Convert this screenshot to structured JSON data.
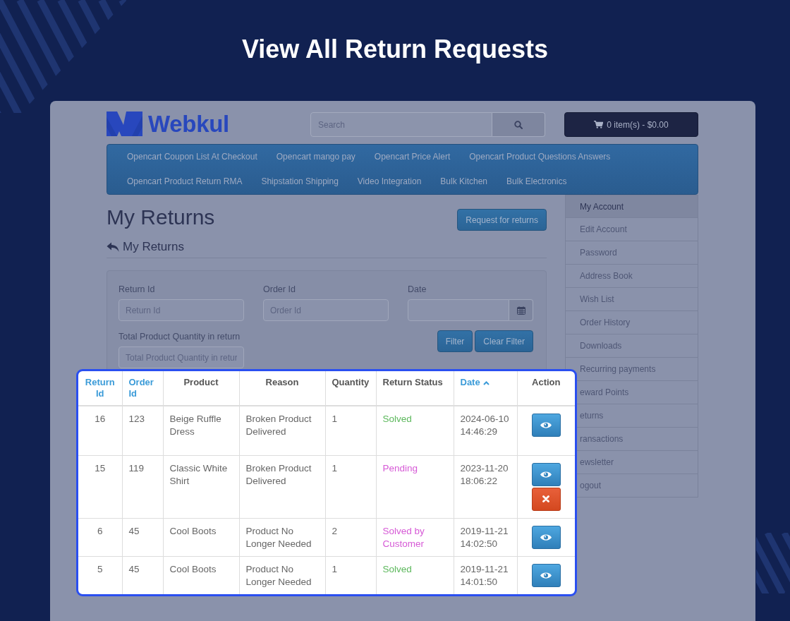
{
  "title": "View All Return Requests",
  "header": {
    "logo": "Webkul",
    "search": {
      "placeholder": "Search"
    },
    "cart": "0 item(s) - $0.00"
  },
  "nav": [
    "Opencart Coupon List At Checkout",
    "Opencart mango pay",
    "Opencart Price Alert",
    "Opencart Product Questions Answers",
    "Opencart Product Return RMA",
    "Shipstation Shipping",
    "Video Integration",
    "Bulk Kitchen",
    "Bulk Electronics"
  ],
  "page": {
    "heading": "My Returns",
    "request_button": "Request for returns",
    "subheading": "My Returns"
  },
  "filters": {
    "fields": [
      {
        "label": "Return Id",
        "kind": "text",
        "placeholder": "Return Id"
      },
      {
        "label": "Order Id",
        "kind": "text",
        "placeholder": "Order Id"
      },
      {
        "label": "Date",
        "kind": "date"
      },
      {
        "label": "Total Product Quantity in return",
        "kind": "text",
        "placeholder": "Total Product Quantity in retur"
      }
    ],
    "buttons": [
      "Filter",
      "Clear Filter"
    ]
  },
  "sidebar": {
    "items": [
      {
        "label": "My Account",
        "selected": true
      },
      {
        "label": "Edit Account",
        "selected": false
      },
      {
        "label": "Password",
        "selected": false
      },
      {
        "label": "Address Book",
        "selected": false
      },
      {
        "label": "Wish List",
        "selected": false
      },
      {
        "label": "Order History",
        "selected": false
      },
      {
        "label": "Downloads",
        "selected": false
      },
      {
        "label": "Recurring payments",
        "selected": false
      },
      {
        "label": "eward Points",
        "selected": false
      },
      {
        "label": "eturns",
        "selected": false
      },
      {
        "label": "ransactions",
        "selected": false
      },
      {
        "label": "ewsletter",
        "selected": false
      },
      {
        "label": "ogout",
        "selected": false
      }
    ]
  },
  "table": {
    "columns": [
      {
        "label": "Return Id",
        "sortable": true,
        "sorted": false
      },
      {
        "label": "Order Id",
        "sortable": true,
        "sorted": false
      },
      {
        "label": "Product",
        "sortable": false,
        "sorted": false
      },
      {
        "label": "Reason",
        "sortable": false,
        "sorted": false
      },
      {
        "label": "Quantity",
        "sortable": false,
        "sorted": false
      },
      {
        "label": "Return Status",
        "sortable": false,
        "sorted": false
      },
      {
        "label": "Date",
        "sortable": true,
        "sorted": true
      },
      {
        "label": "Action",
        "sortable": false,
        "sorted": false
      }
    ],
    "rows": [
      {
        "return_id": "16",
        "order_id": "123",
        "product": "Beige Ruffle Dress",
        "reason": "Broken Product Delivered",
        "quantity": "1",
        "status": {
          "text": "Solved",
          "color": "#5cb85c"
        },
        "date": "2024-06-10 14:46:29",
        "actions": [
          {
            "kind": "view"
          }
        ]
      },
      {
        "return_id": "15",
        "order_id": "119",
        "product": "Classic White Shirt",
        "reason": "Broken Product Delivered",
        "quantity": "1",
        "status": {
          "text": "Pending",
          "color": "#d65ad6"
        },
        "date": "2023-11-20 18:06:22",
        "actions": [
          {
            "kind": "view"
          },
          {
            "kind": "cancel"
          }
        ]
      },
      {
        "return_id": "6",
        "order_id": "45",
        "product": "Cool Boots",
        "reason": "Product No Longer Needed",
        "quantity": "2",
        "status": {
          "text": "Solved by Customer",
          "color": "#d65ad6"
        },
        "date": "2019-11-21 14:02:50",
        "actions": [
          {
            "kind": "view"
          }
        ]
      },
      {
        "return_id": "5",
        "order_id": "45",
        "product": "Cool Boots",
        "reason": "Product No Longer Needed",
        "quantity": "1",
        "status": {
          "text": "Solved",
          "color": "#5cb85c"
        },
        "date": "2019-11-21 14:01:50",
        "actions": [
          {
            "kind": "view"
          }
        ]
      }
    ]
  }
}
